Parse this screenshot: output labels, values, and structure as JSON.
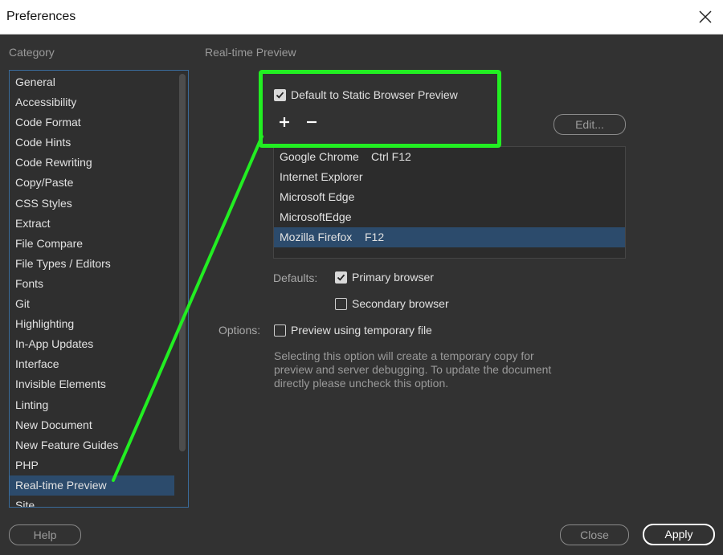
{
  "window": {
    "title": "Preferences",
    "close_icon": "close-icon"
  },
  "sidebar": {
    "heading": "Category",
    "items": [
      {
        "label": "General"
      },
      {
        "label": "Accessibility"
      },
      {
        "label": "Code Format"
      },
      {
        "label": "Code Hints"
      },
      {
        "label": "Code Rewriting"
      },
      {
        "label": "Copy/Paste"
      },
      {
        "label": "CSS Styles"
      },
      {
        "label": "Extract"
      },
      {
        "label": "File Compare"
      },
      {
        "label": "File Types / Editors"
      },
      {
        "label": "Fonts"
      },
      {
        "label": "Git"
      },
      {
        "label": "Highlighting"
      },
      {
        "label": "In-App Updates"
      },
      {
        "label": "Interface"
      },
      {
        "label": "Invisible Elements"
      },
      {
        "label": "Linting"
      },
      {
        "label": "New Document"
      },
      {
        "label": "New Feature Guides"
      },
      {
        "label": "PHP"
      },
      {
        "label": "Real-time Preview",
        "selected": true
      },
      {
        "label": "Site"
      }
    ]
  },
  "panel": {
    "heading": "Real-time Preview",
    "static_preview": {
      "label": "Default to Static Browser Preview",
      "checked": true
    },
    "add_icon": "plus-icon",
    "remove_icon": "minus-icon",
    "edit_label": "Edit...",
    "browsers": [
      {
        "name": "Google Chrome",
        "shortcut": "Ctrl F12"
      },
      {
        "name": "Internet Explorer",
        "shortcut": ""
      },
      {
        "name": "Microsoft Edge",
        "shortcut": ""
      },
      {
        "name": "MicrosoftEdge",
        "shortcut": ""
      },
      {
        "name": "Mozilla Firefox",
        "shortcut": "F12",
        "selected": true
      }
    ],
    "defaults_label": "Defaults:",
    "primary_browser": {
      "label": "Primary browser",
      "checked": true
    },
    "secondary_browser": {
      "label": "Secondary browser",
      "checked": false
    },
    "options_label": "Options:",
    "temp_file": {
      "label": "Preview using temporary file",
      "checked": false
    },
    "hint_text": "Selecting this option will create a temporary copy for preview and server debugging. To update the document directly please uncheck this option."
  },
  "footer": {
    "help": "Help",
    "close": "Close",
    "apply": "Apply"
  },
  "annotation": {
    "color": "#22ee22"
  }
}
